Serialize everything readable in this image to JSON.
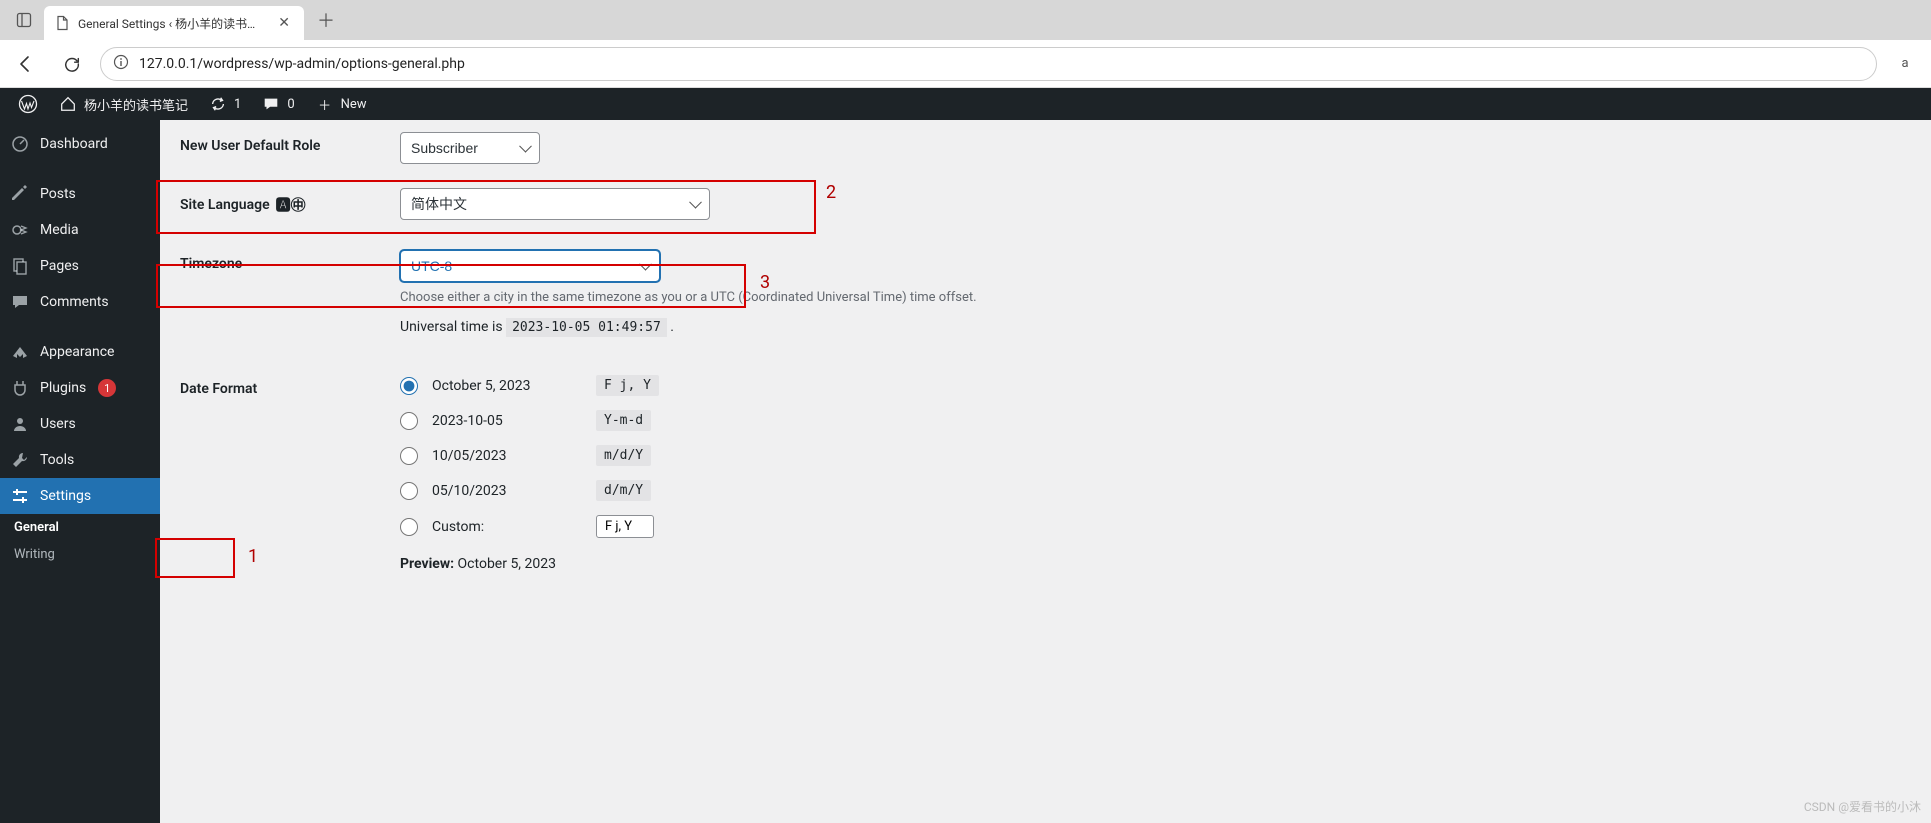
{
  "browser": {
    "tab_title": "General Settings ‹ 杨小羊的读书…",
    "url": "127.0.0.1/wordpress/wp-admin/options-general.php"
  },
  "toolbar": {
    "site_name": "杨小羊的读书笔记",
    "updates_count": "1",
    "comments_count": "0",
    "new_label": "New"
  },
  "adminmenu": {
    "dashboard": "Dashboard",
    "posts": "Posts",
    "media": "Media",
    "pages": "Pages",
    "comments": "Comments",
    "appearance": "Appearance",
    "plugins": "Plugins",
    "plugins_badge": "1",
    "users": "Users",
    "tools": "Tools",
    "settings": "Settings",
    "sub_general": "General",
    "sub_writing": "Writing"
  },
  "form": {
    "new_user_role_label": "New User Default Role",
    "new_user_role_value": "Subscriber",
    "site_language_label": "Site Language",
    "site_language_value": "简体中文",
    "timezone_label": "Timezone",
    "timezone_value": "UTC-8",
    "timezone_desc": "Choose either a city in the same timezone as you or a UTC (Coordinated Universal Time) time offset.",
    "utc_prefix": "Universal time is ",
    "utc_value": "2023-10-05 01:49:57",
    "date_format_label": "Date Format",
    "date_options": [
      {
        "label": "October 5, 2023",
        "code": "F j, Y",
        "checked": true
      },
      {
        "label": "2023-10-05",
        "code": "Y-m-d",
        "checked": false
      },
      {
        "label": "10/05/2023",
        "code": "m/d/Y",
        "checked": false
      },
      {
        "label": "05/10/2023",
        "code": "d/m/Y",
        "checked": false
      }
    ],
    "custom_label": "Custom:",
    "custom_value": "F j, Y",
    "preview_label": "Preview:",
    "preview_value": "October 5, 2023"
  },
  "annotations": {
    "n1": "1",
    "n2": "2",
    "n3": "3"
  },
  "watermark": "CSDN @爱看书的小沐"
}
